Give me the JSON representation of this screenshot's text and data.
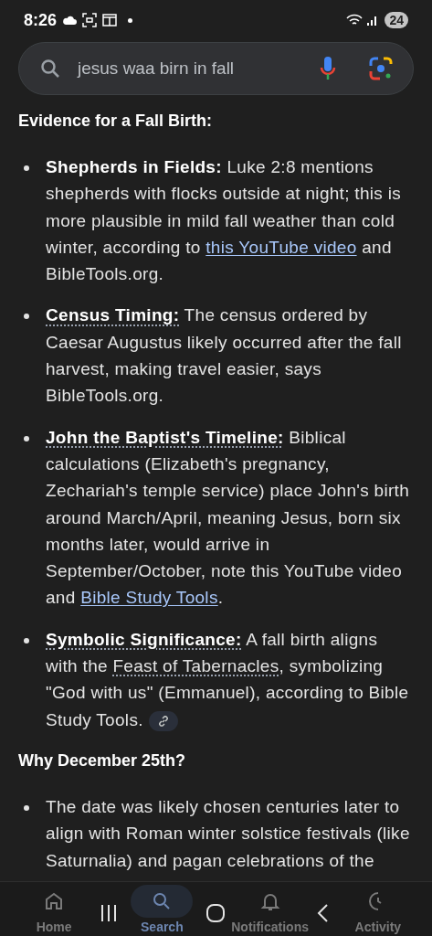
{
  "status_bar": {
    "time": "8:26",
    "battery": "24"
  },
  "search": {
    "value": "jesus waa birn in fall"
  },
  "sections": [
    {
      "heading": "Evidence for a Fall Birth:",
      "bullets": [
        {
          "segments": [
            {
              "kind": "term",
              "text": "Shepherds in Fields:"
            },
            {
              "kind": "text",
              "text": " Luke 2:8 mentions shepherds with flocks outside at night; this is more plausible in mild fall weather than cold winter, according to "
            },
            {
              "kind": "link",
              "text": "this YouTube video"
            },
            {
              "kind": "text",
              "text": " and BibleTools.org."
            }
          ],
          "chip": false
        },
        {
          "segments": [
            {
              "kind": "term_dotted",
              "text": "Census Timing:"
            },
            {
              "kind": "text",
              "text": " The census ordered by Caesar Augustus likely occurred after the fall harvest, making travel easier, says BibleTools.org."
            }
          ],
          "chip": false
        },
        {
          "segments": [
            {
              "kind": "term_dotted",
              "text": "John the Baptist's Timeline:"
            },
            {
              "kind": "text",
              "text": " Biblical calculations (Elizabeth's pregnancy, Zechariah's temple service) place John's birth around March/April, meaning Jesus, born six months later, would arrive in September/October, note this YouTube video and "
            },
            {
              "kind": "link",
              "text": "Bible Study Tools"
            },
            {
              "kind": "text",
              "text": "."
            }
          ],
          "chip": false
        },
        {
          "segments": [
            {
              "kind": "term_dotted",
              "text": "Symbolic Significance:"
            },
            {
              "kind": "text",
              "text": " A fall birth aligns with the "
            },
            {
              "kind": "dotted",
              "text": "Feast of Tabernacles"
            },
            {
              "kind": "text",
              "text": ", symbolizing \"God with us\" (Emmanuel), according to Bible Study Tools."
            }
          ],
          "chip": true
        }
      ]
    },
    {
      "heading": "Why December 25th?",
      "bullets": [
        {
          "segments": [
            {
              "kind": "text",
              "text": "The date was likely chosen centuries later to align with Roman winter solstice festivals (like Saturnalia) and pagan celebrations of the"
            }
          ],
          "chip": false
        }
      ]
    }
  ],
  "bottom_nav": [
    {
      "label": "Home",
      "kind": "home",
      "selected": false
    },
    {
      "label": "Search",
      "kind": "search",
      "selected": true
    },
    {
      "label": "Notifications",
      "kind": "bell",
      "selected": false
    },
    {
      "label": "Activity",
      "kind": "activity",
      "selected": false
    }
  ]
}
